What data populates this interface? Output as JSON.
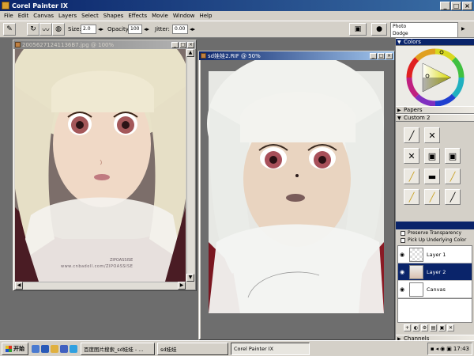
{
  "app": {
    "title": "Corel Painter IX",
    "menus": [
      "File",
      "Edit",
      "Canvas",
      "Layers",
      "Select",
      "Shapes",
      "Effects",
      "Movie",
      "Window",
      "Help"
    ]
  },
  "propbar": {
    "size_label": "Size:",
    "size_value": "2.0",
    "opacity_label": "Opacity:",
    "opacity_value": "100",
    "jitter_label": "Jitter:",
    "jitter_value": "0.00",
    "brush_category": "Photo",
    "brush_variant": "Dodge"
  },
  "windows": {
    "photo": {
      "title": "20056271241136B7.jpg @ 100%",
      "watermark": "www.cnbadoll.com/ZIPOASSISE",
      "watermark2": "ZIPOASSISE"
    },
    "painting": {
      "title": "sd娃娃2.RIF @ 50%"
    }
  },
  "panels": {
    "colors_title": "Colors",
    "papers_title": "Papers",
    "custom_title": "Custom 2",
    "preserve_transparency": "Preserve Transparency",
    "pick_up_underlying": "Pick Up Underlying Color",
    "layers": [
      "Layer 1",
      "Layer 2",
      "Canvas"
    ],
    "channels_title": "Channels"
  },
  "taskbar": {
    "start": "开始",
    "tasks": [
      "百度图片搜索_sd娃娃 - ...",
      "sd娃娃",
      "Corel Painter IX"
    ],
    "clock": "17:43"
  }
}
